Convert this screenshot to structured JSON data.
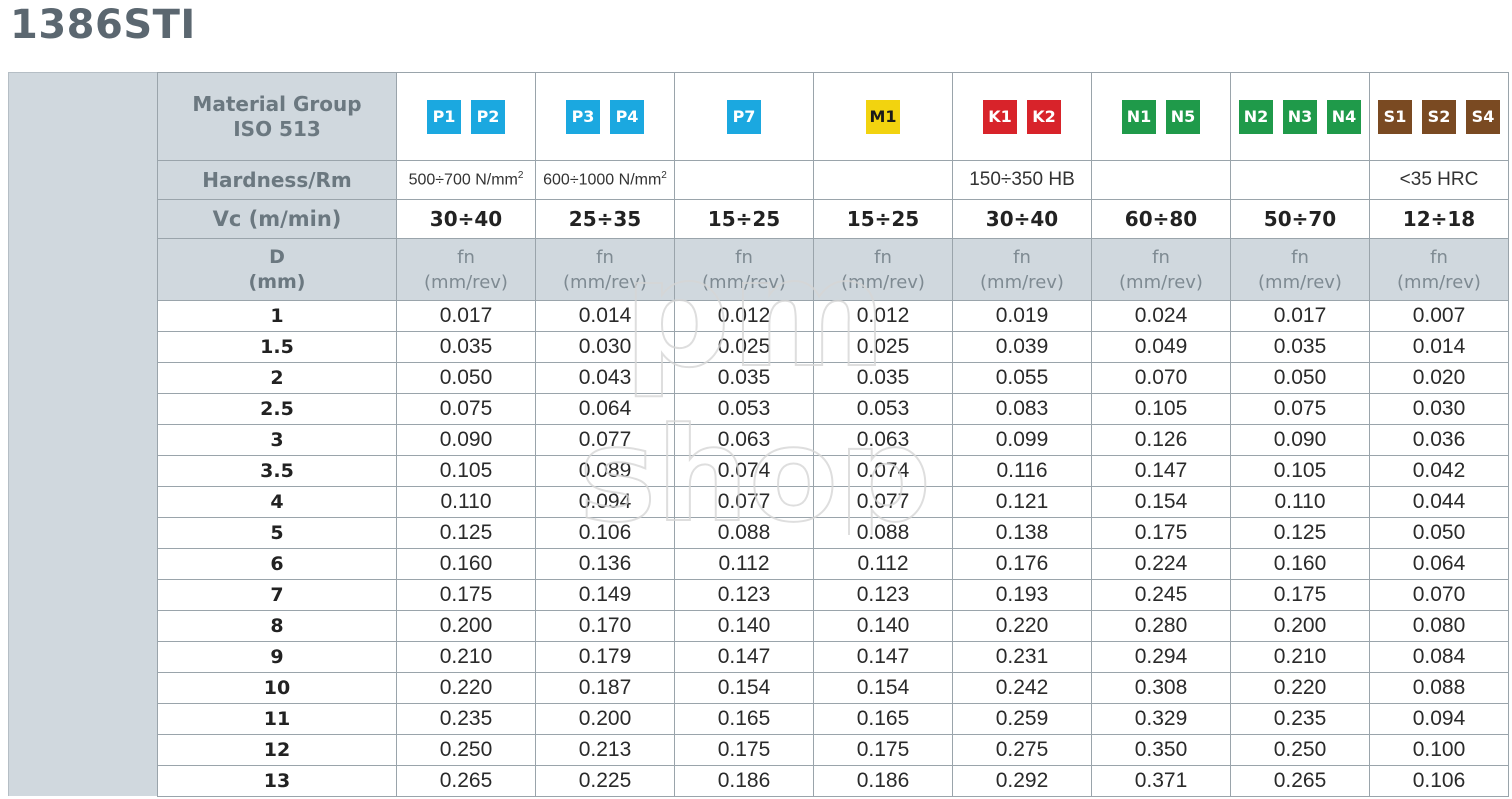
{
  "title": "1386STI",
  "header": {
    "material_label_1": "Material Group",
    "material_label_2": "ISO 513",
    "hardness_label": "Hardness/Rm",
    "vc_label": "Vc (m/min)",
    "d_label_1": "D",
    "d_label_2": "(mm)"
  },
  "groups": [
    {
      "badges": [
        {
          "text": "P1",
          "color": "#1ba8e0"
        },
        {
          "text": "P2",
          "color": "#1ba8e0"
        }
      ],
      "hardness": "500÷700 N/mm",
      "hardness_sup": "2",
      "vc": "30÷40",
      "fn_1": "fn",
      "fn_2": "(mm/rev)"
    },
    {
      "badges": [
        {
          "text": "P3",
          "color": "#1ba8e0"
        },
        {
          "text": "P4",
          "color": "#1ba8e0"
        }
      ],
      "hardness": "600÷1000 N/mm",
      "hardness_sup": "2",
      "vc": "25÷35",
      "fn_1": "fn",
      "fn_2": "(mm/rev)"
    },
    {
      "badges": [
        {
          "text": "P7",
          "color": "#1ba8e0"
        }
      ],
      "hardness": "",
      "vc": "15÷25",
      "fn_1": "fn",
      "fn_2": "(mm/rev)"
    },
    {
      "badges": [
        {
          "text": "M1",
          "color": "#f2d30f",
          "dark": true
        }
      ],
      "hardness": "",
      "vc": "15÷25",
      "fn_1": "fn",
      "fn_2": "(mm/rev)"
    },
    {
      "badges": [
        {
          "text": "K1",
          "color": "#d8232a"
        },
        {
          "text": "K2",
          "color": "#d8232a"
        }
      ],
      "hardness": "150÷350 HB",
      "vc": "30÷40",
      "fn_1": "fn",
      "fn_2": "(mm/rev)"
    },
    {
      "badges": [
        {
          "text": "N1",
          "color": "#1f9a4a"
        },
        {
          "text": "N5",
          "color": "#1f9a4a"
        }
      ],
      "hardness": "",
      "vc": "60÷80",
      "fn_1": "fn",
      "fn_2": "(mm/rev)"
    },
    {
      "badges": [
        {
          "text": "N2",
          "color": "#1f9a4a"
        },
        {
          "text": "N3",
          "color": "#1f9a4a"
        },
        {
          "text": "N4",
          "color": "#1f9a4a"
        }
      ],
      "hardness": "",
      "vc": "50÷70",
      "fn_1": "fn",
      "fn_2": "(mm/rev)"
    },
    {
      "badges": [
        {
          "text": "S1",
          "color": "#7a4a22"
        },
        {
          "text": "S2",
          "color": "#7a4a22"
        },
        {
          "text": "S4",
          "color": "#7a4a22"
        }
      ],
      "hardness": "<35 HRC",
      "vc": "12÷18",
      "fn_1": "fn",
      "fn_2": "(mm/rev)"
    }
  ],
  "rows": [
    {
      "d": "1",
      "v": [
        "0.017",
        "0.014",
        "0.012",
        "0.012",
        "0.019",
        "0.024",
        "0.017",
        "0.007"
      ]
    },
    {
      "d": "1.5",
      "v": [
        "0.035",
        "0.030",
        "0.025",
        "0.025",
        "0.039",
        "0.049",
        "0.035",
        "0.014"
      ]
    },
    {
      "d": "2",
      "v": [
        "0.050",
        "0.043",
        "0.035",
        "0.035",
        "0.055",
        "0.070",
        "0.050",
        "0.020"
      ]
    },
    {
      "d": "2.5",
      "v": [
        "0.075",
        "0.064",
        "0.053",
        "0.053",
        "0.083",
        "0.105",
        "0.075",
        "0.030"
      ]
    },
    {
      "d": "3",
      "v": [
        "0.090",
        "0.077",
        "0.063",
        "0.063",
        "0.099",
        "0.126",
        "0.090",
        "0.036"
      ]
    },
    {
      "d": "3.5",
      "v": [
        "0.105",
        "0.089",
        "0.074",
        "0.074",
        "0.116",
        "0.147",
        "0.105",
        "0.042"
      ]
    },
    {
      "d": "4",
      "v": [
        "0.110",
        "0.094",
        "0.077",
        "0.077",
        "0.121",
        "0.154",
        "0.110",
        "0.044"
      ]
    },
    {
      "d": "5",
      "v": [
        "0.125",
        "0.106",
        "0.088",
        "0.088",
        "0.138",
        "0.175",
        "0.125",
        "0.050"
      ]
    },
    {
      "d": "6",
      "v": [
        "0.160",
        "0.136",
        "0.112",
        "0.112",
        "0.176",
        "0.224",
        "0.160",
        "0.064"
      ]
    },
    {
      "d": "7",
      "v": [
        "0.175",
        "0.149",
        "0.123",
        "0.123",
        "0.193",
        "0.245",
        "0.175",
        "0.070"
      ]
    },
    {
      "d": "8",
      "v": [
        "0.200",
        "0.170",
        "0.140",
        "0.140",
        "0.220",
        "0.280",
        "0.200",
        "0.080"
      ]
    },
    {
      "d": "9",
      "v": [
        "0.210",
        "0.179",
        "0.147",
        "0.147",
        "0.231",
        "0.294",
        "0.210",
        "0.084"
      ]
    },
    {
      "d": "10",
      "v": [
        "0.220",
        "0.187",
        "0.154",
        "0.154",
        "0.242",
        "0.308",
        "0.220",
        "0.088"
      ]
    },
    {
      "d": "11",
      "v": [
        "0.235",
        "0.200",
        "0.165",
        "0.165",
        "0.259",
        "0.329",
        "0.235",
        "0.094"
      ]
    },
    {
      "d": "12",
      "v": [
        "0.250",
        "0.213",
        "0.175",
        "0.175",
        "0.275",
        "0.350",
        "0.250",
        "0.100"
      ]
    },
    {
      "d": "13",
      "v": [
        "0.265",
        "0.225",
        "0.186",
        "0.186",
        "0.292",
        "0.371",
        "0.265",
        "0.106"
      ]
    }
  ],
  "watermark": {
    "line_1": "pm",
    "line_2": "shop"
  }
}
